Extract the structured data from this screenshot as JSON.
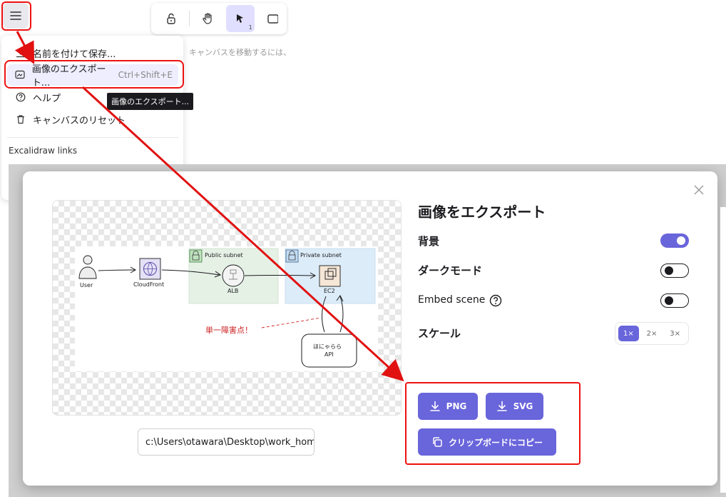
{
  "toolbar": {
    "select_badge": "1"
  },
  "canvas_hint": "キャンバスを移動するには、",
  "menu": {
    "items": [
      {
        "label": "名前を付けて保存...",
        "shortcut": ""
      },
      {
        "label": "画像のエクスポート...",
        "shortcut": "Ctrl+Shift+E"
      },
      {
        "label": "ヘルプ",
        "shortcut": ""
      },
      {
        "label": "キャンバスのリセット",
        "shortcut": ""
      }
    ],
    "section_label": "Excalidraw links",
    "tooltip": "画像のエクスポート..."
  },
  "dialog": {
    "title": "画像をエクスポート",
    "options": {
      "background": {
        "label": "背景",
        "on": true
      },
      "dark_mode": {
        "label": "ダークモード",
        "on": false
      },
      "embed_scene": {
        "label": "Embed scene",
        "on": false
      },
      "scale": {
        "label": "スケール",
        "values": [
          "1×",
          "2×",
          "3×"
        ],
        "selected": "1×"
      }
    },
    "filename": "c:\\Users\\otawara\\Desktop\\work_home",
    "buttons": {
      "png": "PNG",
      "svg": "SVG",
      "clipboard": "クリップボードにコピー"
    }
  },
  "diagram": {
    "user": "User",
    "cloudfront": "CloudFront",
    "public_subnet": "Public subnet",
    "private_subnet": "Private subnet",
    "alb": "ALB",
    "ec2": "EC2",
    "spof": "単一障害点！",
    "api_line1": "ほにゃらら",
    "api_line2": "API"
  },
  "colors": {
    "accent": "#6965db",
    "annotation_red": "#e11111",
    "public_subnet_fill": "#e6f1e6",
    "private_subnet_fill": "#dcecf8"
  }
}
